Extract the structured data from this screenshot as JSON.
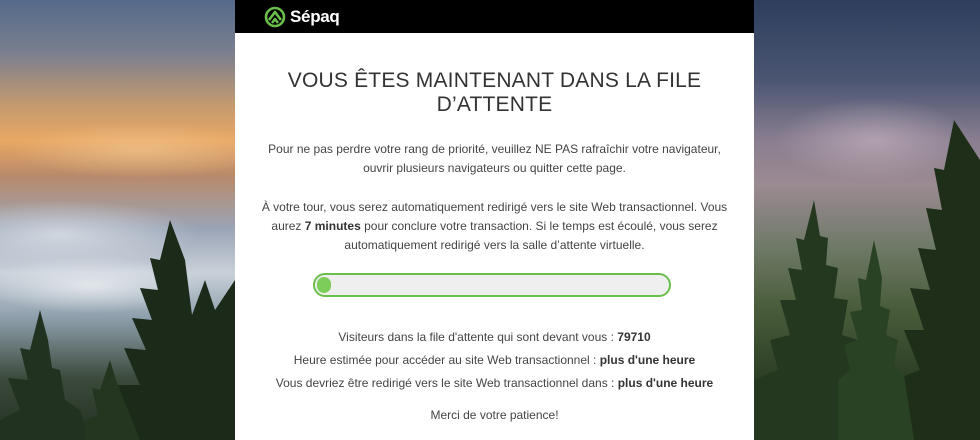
{
  "brand": {
    "name": "Sépaq",
    "accent": "#6abf4b"
  },
  "queue": {
    "title": "VOUS ÊTES MAINTENANT DANS LA FILE D’ATTENTE",
    "paragraph1": "Pour ne pas perdre votre rang de priorité, veuillez NE PAS rafraîchir votre navigateur, ouvrir plusieurs navigateurs ou quitter cette page.",
    "paragraph2_before": "À votre tour, vous serez automatiquement redirigé vers le site Web transactionnel. Vous aurez ",
    "paragraph2_bold": "7 minutes",
    "paragraph2_after": " pour conclure votre transaction. Si le temps est écoulé, vous serez automatiquement redirigé vers la salle d’attente virtuelle.",
    "progress_fraction": 0.04,
    "visitors_label": "Visiteurs dans la file d'attente qui sont devant vous : ",
    "visitors_value": "79710",
    "estimated_label": "Heure estimée pour accéder au site Web transactionnel : ",
    "estimated_value": "plus d'une heure",
    "redirect_label": "Vous devriez être redirigé vers le site Web transactionnel dans : ",
    "redirect_value": "plus d'une heure",
    "thanks": "Merci de votre patience!"
  }
}
